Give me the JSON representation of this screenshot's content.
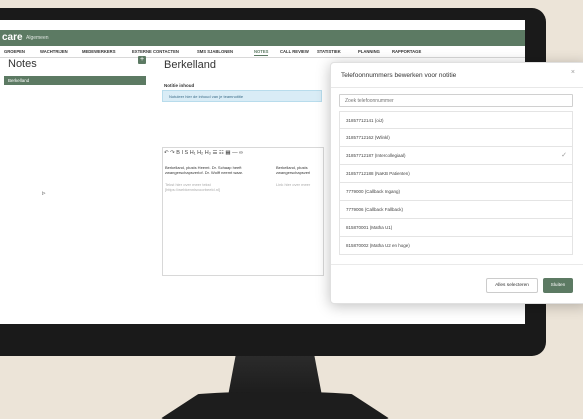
{
  "app": {
    "brand": "care",
    "brand_sub": "Algemeen"
  },
  "nav": {
    "tabs": [
      "GROEPEN",
      "WACHTRIJEN",
      "MEDEWERKERS",
      "EXTERNE CONTACTEN",
      "SMS SJABLONEN",
      "NOTES",
      "CALL REVIEW",
      "STATISTIEK",
      "PLANNING",
      "RAPPORTAGE"
    ],
    "active": "NOTES"
  },
  "sidebar": {
    "title": "Notes",
    "add_label": "+",
    "items": [
      "Berkelland"
    ]
  },
  "main": {
    "title": "Berkelland",
    "field_label": "Notitie inhoud",
    "info_text": "Notuleer hier de inhoud van je teamnotitie",
    "toolbar": "↶  ↷    B  I  S    H₁ H₂ H₃    ☰  ☷  ▦    —  ∞",
    "editor_text_1": "Berkelland, plusts Heemt. Dr. Schaap heeft",
    "editor_text_2": "zwangerschapsverlof. Dr. Wolff neemt waar.",
    "editor_placeholder_1": "Tekst hier over meer tekst",
    "editor_placeholder_2": "[https://webkennisvoorbeeld.nl]",
    "editor2_text_1": "Berkelland, plusts",
    "editor2_text_2": "zwangerschapsverl",
    "editor2_placeholder": "Link hier over meer"
  },
  "modal": {
    "title": "Telefoonnummers bewerken voor notitie",
    "close_icon": "×",
    "search_placeholder": "Zoek telefoonnummer",
    "options": [
      {
        "label": "31857712141 (oiJ)",
        "selected": false
      },
      {
        "label": "31857712162 (Wlinkl)",
        "selected": false
      },
      {
        "label": "31857712187 (Intercollegiaal)",
        "selected": true
      },
      {
        "label": "31857712188 (NaKB Patienten)",
        "selected": false
      },
      {
        "label": "7779000 (Callback Ingang)",
        "selected": false
      },
      {
        "label": "7779006 (Callback Fallback)",
        "selected": false
      },
      {
        "label": "815870001 (Matha U1)",
        "selected": false
      },
      {
        "label": "815870002 (Matha U2 en hoge)",
        "selected": false
      }
    ],
    "check_icon": "✓",
    "select_all_label": "Alles selecteren",
    "close_label": "Sluiten"
  },
  "colors": {
    "accent": "#5c7a63",
    "info_bg": "#d9ecf6",
    "backdrop": "#ece4d8"
  }
}
